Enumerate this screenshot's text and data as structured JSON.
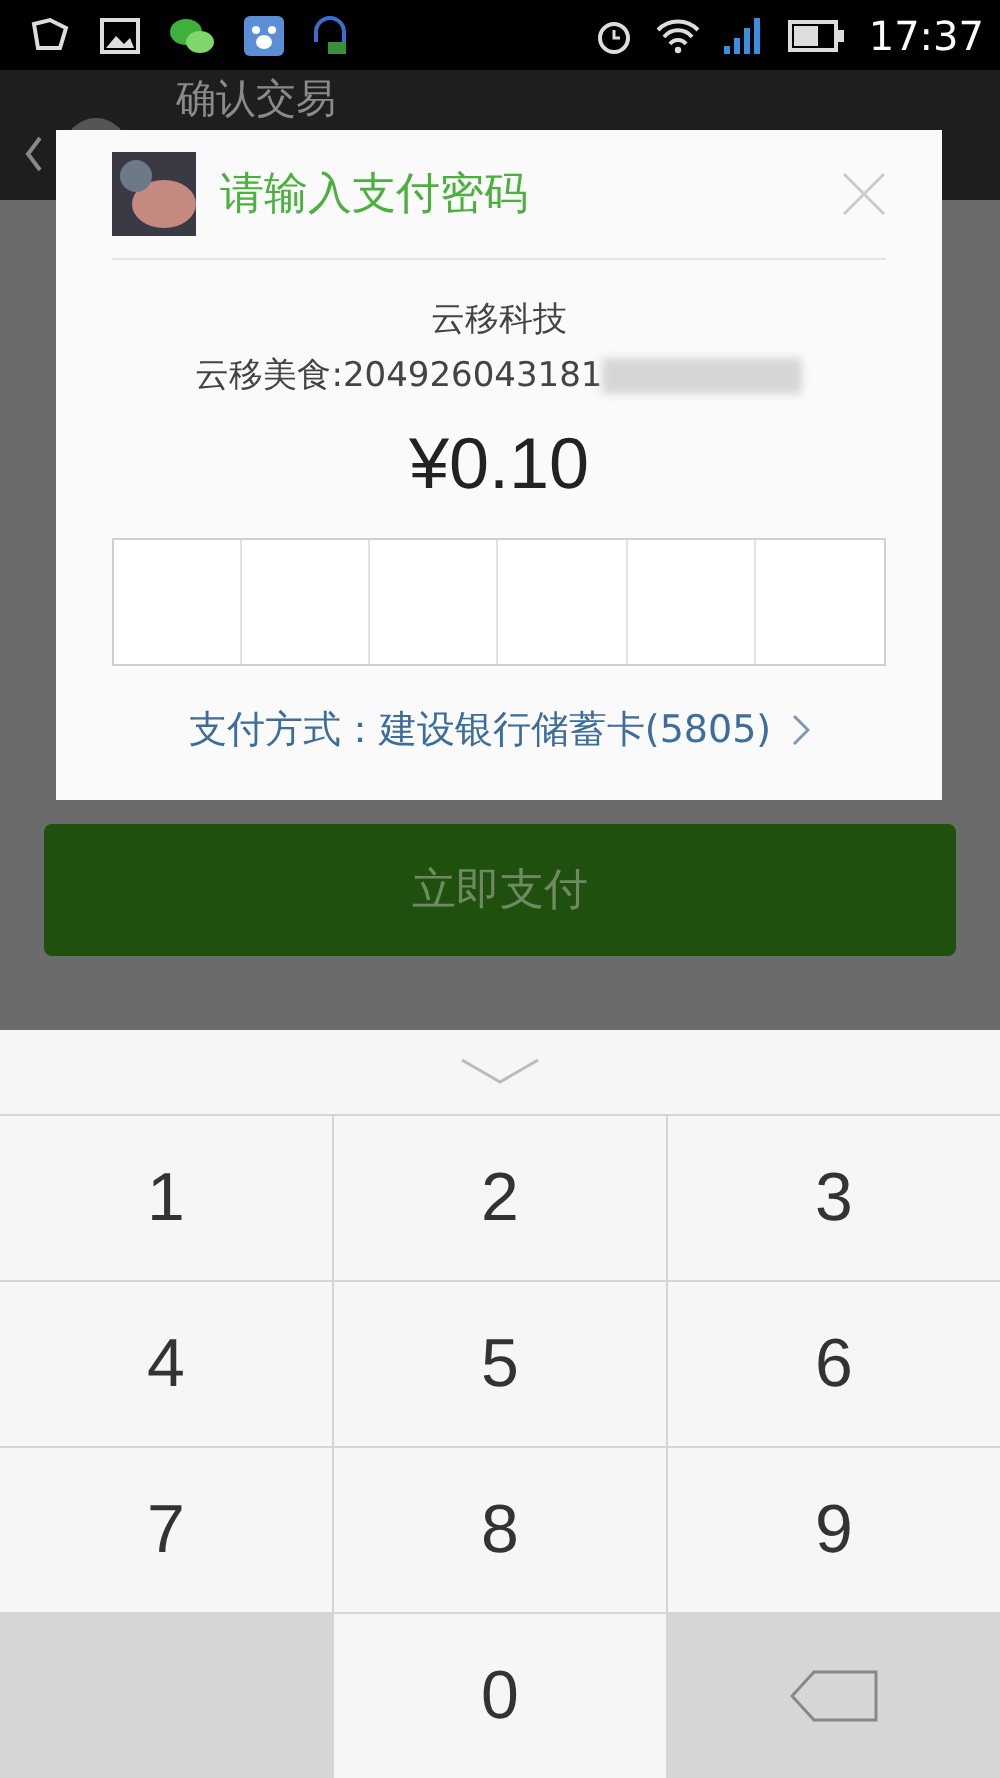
{
  "status_bar": {
    "time": "17:37"
  },
  "header": {
    "title": "确认交易"
  },
  "dialog": {
    "title": "请输入支付密码",
    "merchant": "云移科技",
    "order": "云移美食:204926043181",
    "amount": "¥0.10",
    "payment_method": "支付方式：建设银行储蓄卡(5805)"
  },
  "pay_button": {
    "label": "立即支付"
  },
  "keypad": [
    {
      "kind": "digit",
      "label": "1"
    },
    {
      "kind": "digit",
      "label": "2"
    },
    {
      "kind": "digit",
      "label": "3"
    },
    {
      "kind": "digit",
      "label": "4"
    },
    {
      "kind": "digit",
      "label": "5"
    },
    {
      "kind": "digit",
      "label": "6"
    },
    {
      "kind": "digit",
      "label": "7"
    },
    {
      "kind": "digit",
      "label": "8"
    },
    {
      "kind": "digit",
      "label": "9"
    },
    {
      "kind": "blank"
    },
    {
      "kind": "digit",
      "label": "0"
    },
    {
      "kind": "backspace"
    }
  ]
}
